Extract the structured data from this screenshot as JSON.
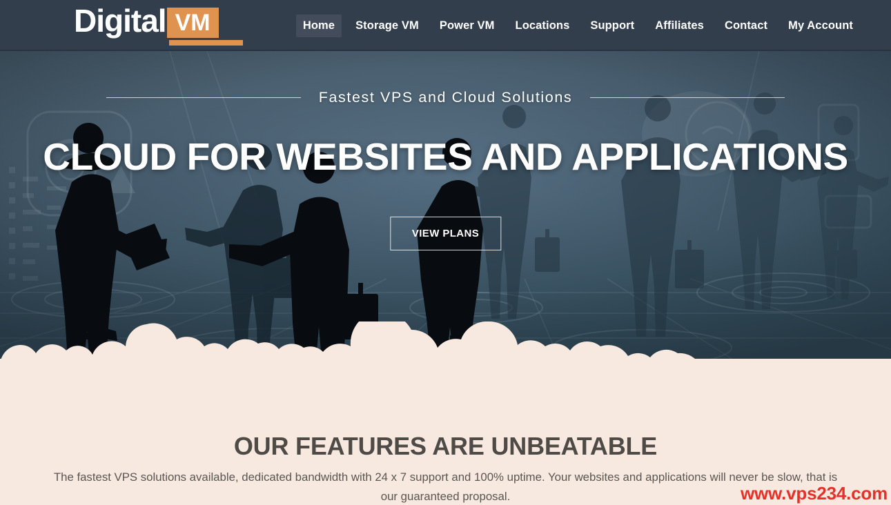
{
  "header": {
    "logo": {
      "word": "Digital",
      "badge": "VM"
    },
    "nav": [
      {
        "label": "Home",
        "active": true
      },
      {
        "label": "Storage VM",
        "active": false
      },
      {
        "label": "Power VM",
        "active": false
      },
      {
        "label": "Locations",
        "active": false
      },
      {
        "label": "Support",
        "active": false
      },
      {
        "label": "Affiliates",
        "active": false
      },
      {
        "label": "Contact",
        "active": false
      },
      {
        "label": "My Account",
        "active": false
      }
    ]
  },
  "hero": {
    "tagline": "Fastest VPS and Cloud Solutions",
    "title": "CLOUD FOR WEBSITES AND APPLICATIONS",
    "cta_label": "VIEW PLANS"
  },
  "features": {
    "title": "OUR FEATURES ARE UNBEATABLE",
    "description": "The fastest VPS solutions available, dedicated bandwidth with 24 x 7 support and 100% uptime. Your websites and applications will never be slow, that is our guaranteed proposal."
  },
  "watermark": "www.vps234.com",
  "colors": {
    "header_bg": "#333E4D",
    "logo_accent": "#E0934F",
    "cream": "#F7E9E0",
    "hero_blue": "#41586A",
    "heading_gray": "#4E4A46",
    "watermark_red": "#E8302B"
  }
}
